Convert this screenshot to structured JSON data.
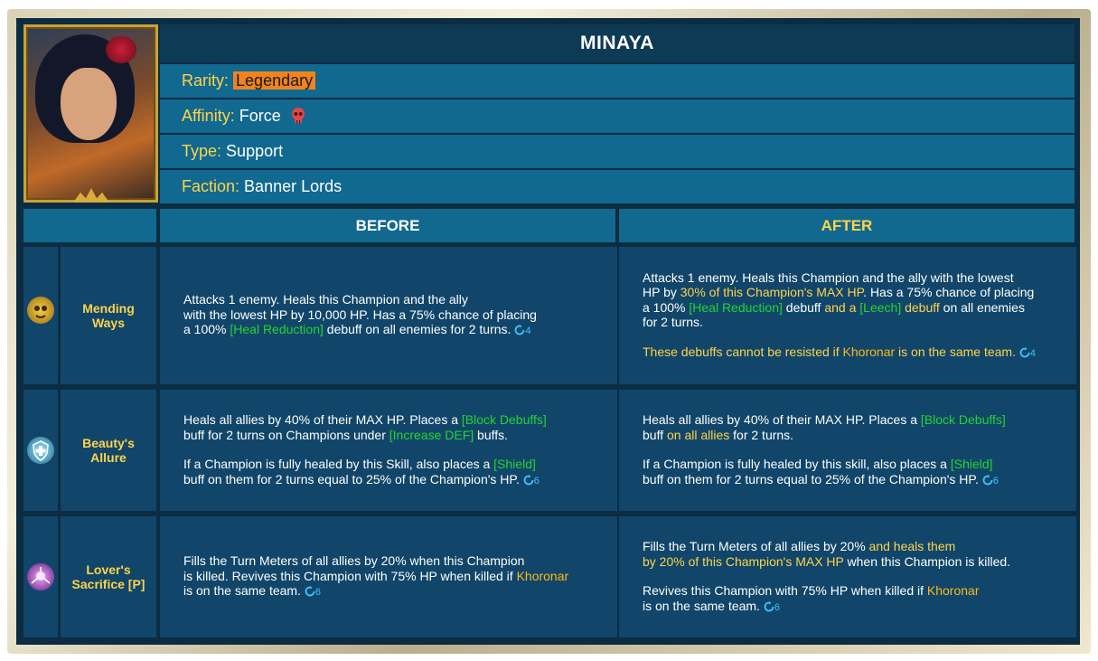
{
  "champion": {
    "name": "MINAYA",
    "rarity_label": "Rarity:",
    "rarity": "Legendary",
    "affinity_label": "Affinity:",
    "affinity": "Force",
    "affinity_icon": "skull-icon",
    "type_label": "Type:",
    "type": "Support",
    "faction_label": "Faction:",
    "faction": "Banner Lords"
  },
  "columns": {
    "before": "BEFORE",
    "after": "AFTER"
  },
  "colors": {
    "accent_yellow": "#ffd34a",
    "keyword_green": "#24d430",
    "champion_orange": "#ffb71a",
    "cooldown_blue": "#3cc3ff",
    "rarity_orange": "#f0831e"
  },
  "skills": [
    {
      "name_line1": "Mending",
      "name_line2": "Ways",
      "icon": "golden-mask-icon",
      "before": {
        "t1": "Attacks 1 enemy. Heals this Champion and the ally",
        "t2": "with the lowest HP by 10,000 HP. Has a 75% chance of placing",
        "t3": "a 100% ",
        "g1": "[Heal Reduction]",
        "t4": " debuff on all enemies for 2 turns.",
        "cooldown": "4"
      },
      "after": {
        "t1": "Attacks 1 enemy. Heals this Champion and the ally with the lowest",
        "t2": "HP by ",
        "y1": "30% of this Champion's MAX HP",
        "t3": ". Has a 75% chance of placing",
        "t4": "a 100% ",
        "g1": "[Heal Reduction]",
        "t5": " debuff ",
        "y2": "and a ",
        "g2": "[Leech]",
        "y3": " debuff",
        "t6": " on all enemies",
        "t7": "for 2 turns.",
        "p2a": "These debuffs cannot be resisted if ",
        "p2b": "Khoronar",
        "p2c": " is on the same team.",
        "cooldown": "4"
      }
    },
    {
      "name_line1": "Beauty's",
      "name_line2": "Allure",
      "icon": "shield-cross-icon",
      "before": {
        "t1": "Heals all allies by 40% of their MAX HP. Places a ",
        "g1": "[Block Debuffs]",
        "t2": "buff for 2 turns on Champions under ",
        "g2": "[Increase DEF]",
        "t3": " buffs.",
        "p2a": "If a Champion is fully healed by this Skill, also places a ",
        "g3": "[Shield]",
        "p2b": "buff on them for 2 turns equal to 25% of the Champion's HP.",
        "cooldown": "6"
      },
      "after": {
        "t1": "Heals all allies by 40% of their MAX HP. Places a ",
        "g1": "[Block Debuffs]",
        "t2": "buff ",
        "y1": "on all allies",
        "t3": " for 2 turns.",
        "p2a": "If a Champion is fully healed by this skill, also places a ",
        "g2": "[Shield]",
        "p2b": "buff on them for 2 turns equal to 25% of the Champion's HP.",
        "cooldown": "6"
      }
    },
    {
      "name_line1": "Lover's",
      "name_line2": "Sacrifice [P]",
      "icon": "sacrifice-hand-icon",
      "before": {
        "t1": "Fills the Turn Meters of all allies by 20% when this Champion",
        "t2": "is killed. Revives this Champion with 75% HP when killed if ",
        "o1": "Khoronar",
        "t3": "is on the same team.",
        "cooldown": "6"
      },
      "after": {
        "t1": "Fills the Turn Meters of all allies by 20% ",
        "y1": "and heals them",
        "y2": "by 20% of this Champion's MAX HP",
        "t2": " when this Champion is killed.",
        "p2a": "Revives this Champion with 75% HP when killed if ",
        "o1": "Khoronar",
        "p2b": "is on the same team.",
        "cooldown": "6"
      }
    }
  ]
}
